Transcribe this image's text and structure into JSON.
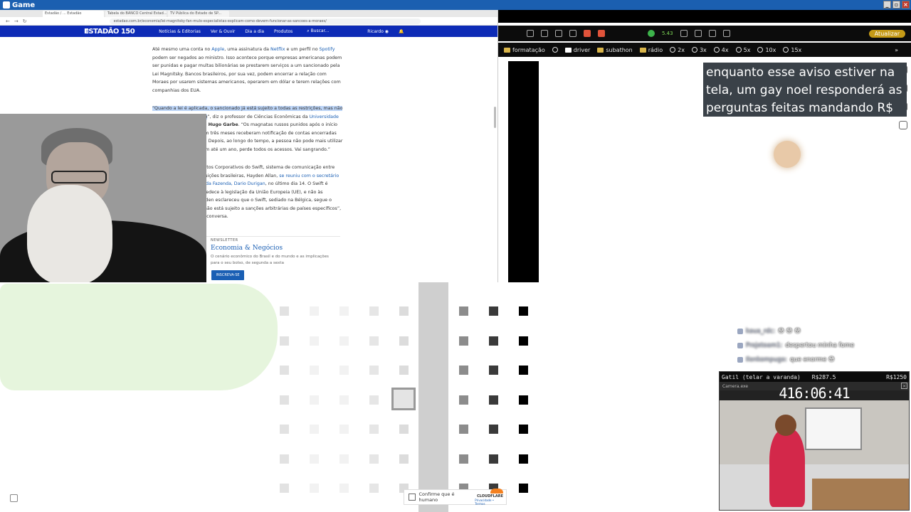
{
  "window": {
    "title": "Game"
  },
  "left_browser": {
    "tabs": [
      "Estadão / ... Estadão",
      "Tabela do BANCO Central Estad...",
      "TV Pública do Estado de SP..."
    ],
    "url": "estadao.com.br/economia/lei-magnitsky-fan-mulo-especialistas-explicam-como-devem-funcionar-as-sancoes-a-moraes/",
    "site": {
      "logo": "ESTADÃO 150",
      "nav": [
        "Notícias & Editorias",
        "Ver & Ouvir",
        "Dia a dia",
        "Produtos"
      ],
      "search": "Buscar...",
      "user": "Ricardo"
    },
    "article": {
      "p1_pre": "Até mesmo uma conta no ",
      "p1_apple": "Apple",
      "p1_mid1": ", uma assinatura da ",
      "p1_netflix": "Netflix",
      "p1_mid2": " e um perfil no ",
      "p1_spotify": "Spotify",
      "p1_rest": " podem ser negados ao ministro. Isso acontece porque empresas americanas podem ser punidas e pagar multas bilionárias se prestarem serviços a um sancionado pela Lei Magnitsky. Bancos brasileiros, por sua vez, podem encerrar a relação com Moraes por usarem sistemas americanos, operarem em dólar e terem relações com companhias dos EUA.",
      "p2_quote": "“Quando a lei é aplicada, o sancionado já está sujeito a todas as restrições, mas não é tudo ao mesmo tempo",
      "p2_pre": "”, diz o professor de Ciências Econômicas da ",
      "p2_univ": "Universidade Presbiteriana Mackenzie",
      "p2_name": " Hugo Garbe",
      "p2_rest": ". “Os magnatas russos punidos após o início da Guerra na Ucrânia em três meses receberam notificação de contas encerradas em plataformas digitais. Depois, ao longo do tempo, a pessoa não pode mais utilizar os cartões de crédito. Em até um ano, perde todos os acessos. Vai sangrando.”",
      "p3_pre": "O chefe global de Assuntos Corporativos do Swift, sistema de comunicação entre bancos usado por instituições brasileiras, Hayden Allan, ",
      "p3_link": "se reuniu com o secretário executivo do Ministério da Fazenda, Dario Durigan",
      "p3_rest": ", no último dia 14. O Swift é sediado na Bélgica e obedece à legislação da União Europeia (UE), e não às decisões dos EUA. “Hayden esclareceu que o Swift, sediado na Bélgica, segue o marco legal europeu e não está sujeito a sanções arbitrárias de países específicos”, afirmou Durigan após a conversa."
    },
    "newsletter": {
      "tag": "NEWSLETTER",
      "title": "Economia & Negócios",
      "desc": "O cenário econômico do Brasil e do mundo e as implicações para o seu bolso, de segunda a sexta",
      "button": "INSCREVA-SE"
    }
  },
  "right_browser": {
    "toolbar_badge": "5.43",
    "update_button": "Atualizar",
    "bookmarks": [
      "formatação",
      "driver",
      "subathon",
      "rádio",
      "2x",
      "3x",
      "4x",
      "5x",
      "10x",
      "15x"
    ]
  },
  "overlay": {
    "text": "enquanto esse aviso estiver na tela, um gay noel responderá as perguntas feitas mandando R$ 6"
  },
  "captcha": {
    "label": "Confirme que é humano",
    "brand": "CLOUDFLARE",
    "links": "Privacidade • Termos"
  },
  "chat": [
    {
      "user": "kaua_rdc:",
      "message": "😳 😳 😳"
    },
    {
      "user": "Projetoam1:",
      "message": "despertou minha fome"
    },
    {
      "user": "Ilonkompugo:",
      "message": "que enorme 😳"
    }
  ],
  "mini_stream": {
    "title": "Gatil (telar a varanda)",
    "price1": "R$287.5",
    "price2": "R$1250",
    "subtitle": "Camera.exe",
    "timer": "416:06:41"
  }
}
